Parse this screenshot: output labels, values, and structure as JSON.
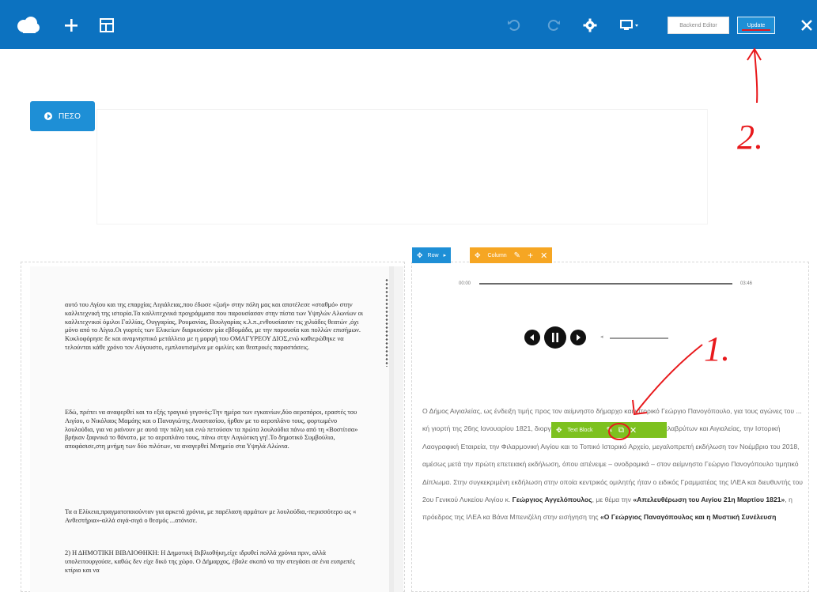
{
  "toolbar": {
    "backend_editor_label": "Backend Editor",
    "update_label": "Update",
    "icons": [
      "logo-cloud-icon",
      "add-icon",
      "templates-icon",
      "undo-icon",
      "redo-icon",
      "settings-gear-icon",
      "responsive-preview-icon",
      "close-icon"
    ],
    "accent": "#0c72c0"
  },
  "page": {
    "button_label": "ΠΕΣΟ"
  },
  "controls": {
    "row_label": "Row",
    "column_label": "Column",
    "text_block_label": "Text Block",
    "row_color": "#1e8fd6",
    "column_color": "#f6a623",
    "text_block_color": "#7dc11f"
  },
  "audio": {
    "current_time": "00:00",
    "duration": "03:46"
  },
  "scan": {
    "paragraphs": [
      "αυτό του Αγίου και της επαρχίας Αιγιάλειας,που έδωσε «ζωή» στην πόλη μας και αποτέλεσε «σταθμό» στην καλλιτεχνική της ιστορία.Τα καλλιτεχνικά προγράμματα που παρουσίασαν στην πίστα των Υψηλών Αλωνίων οι καλλιτεχνικοί όμιλοι Γαλλίας, Ουγγαρίας, Ρουμανίας, Βουλγαρίας κ.λ.π.,ενθουσίασαν τις χιλιάδες θεατών ,όχι μόνο από το Αίγιο.Οι γιορτές των Ελικείων διαρκούσαν μία εβδομάδα, με την παρουσία και πολλών επισήμων. Κυκλοφόρησε δε και αναμνηστικό μετάλλειο με η μορφή του ΟΜΑΓΥΡΕΟΥ ΔΙΟΣ,ενώ καθιερώθηκε να τελούνται κάθε χρόνο τον Αύγουστο, εμπλουτισμένα με ομιλίες και θεατρικές παραστάσεις.",
      "Εδώ, πρέπει να αναφερθεί και το εξής τραγικό γεγονός:Την ημέρα των εγκαινίων,δύο αεροπόροι, εραστές του Αιγίου, ο Νικόλαος Μαμάης και ο Παναγιώτης Αναστασίου, ήρθαν με το αεροπλάνο τους, φορτωμένο λουλούδια, για να ραίνουν με αυτά την πόλη και ενώ πετούσαν τα πρώτα λουλούδια πάνω από τη «Βοστίτσα» βρήκαν ξαφνικά το θάνατο, με το αεροπλάνο τους, πάνω στην Αιγιώτικη γη!.Το δημοτικό Συμβούλιο, αποφάσισε,στη μνήμη των δύο πιλότων, να αναγερθεί Μνημείο στα Υψηλά Αλώνια.",
      "Τα α Ελίκεια,πραγματοποιούνταν για αρκετά χρόνια, με παρέλαση αρμάτων με λουλούδια,-περισσότερο ως « Ανθεστήρια»-αλλά σιγά-σιγά ο θεσμός ...ατόνισε.",
      "2) Η ΔΗΜΟΤΙΚΗ ΒΙΒΛΙΟΘΗΚΗ: Η Δημοτική Βιβλιοθήκη,είχε ιδρυθεί πολλά χρόνια πριν, αλλά υπολειτουργούσε, καθώς δεν είχε δικό της χώρο. Ο Δήμαρχος, έβαλε σκοπό να την στεγάσει σε ένα ευπρεπές κτίριο και να"
    ]
  },
  "article": {
    "text": "Ο Δήμος Αιγιαλείας, ως ένδειξη τιμής προς τον αείμνηστο δήμαρχο και ιστορικό Γεώργιο Πανογόπουλο, για τους αγώνες του ... κή γιορτή της 26ης Ιανουαρίου 1821, διοργάνωσε μαζί με την Ιερά Μητρόπολη Καλαβρύτων και Αιγιαλείας, την Ιστορική Λαογραφική Εταιρεία, την Φιλαρμονική Αιγίου και το Τοπικό Ιστορικό Αρχείο, μεγαλοπρεπή εκδήλωση τον Νοέμβριο του 2018, αμέσως μετά την πρώτη επετειακή εκδήλωση, όπου απένειμε – ονοδρομικά – στον αείμνηστο Γεώργιο Πανογόπουλο τιμητικό Δίπλωμα. Στην συγκεκριμένη εκδήλωση στην οποία κεντρικός ομιλητής ήταν ο ειδικός Γραμματέας της ΙΛΕΑ και διευθυντής του 2ου Γενικού Λυκείου Αιγίου κ. Γεώργιος Αγγελόπουλος, με θέμα την «Απελευθέρωση του Αιγίου 21η Μαρτίου 1821», η πρόεδρος της ΙΛΕΑ κα Βάνα Μπενιζέλη στην εισήγηση της «Ο Γεώργιος Παναγόπουλος και η Μυστική Συνέλευση",
    "bold_1": "Γεώργιος Αγγελόπουλος",
    "bold_2": "«Απελευθέρωση του Αιγίου 21η Μαρτίου 1821»",
    "bold_3": "«Ο Γεώργιος Παναγόπουλος και η Μυστική Συνέλευση"
  },
  "annotations": {
    "mark_1": "1.",
    "mark_2": "2.",
    "color": "#e8191c"
  }
}
